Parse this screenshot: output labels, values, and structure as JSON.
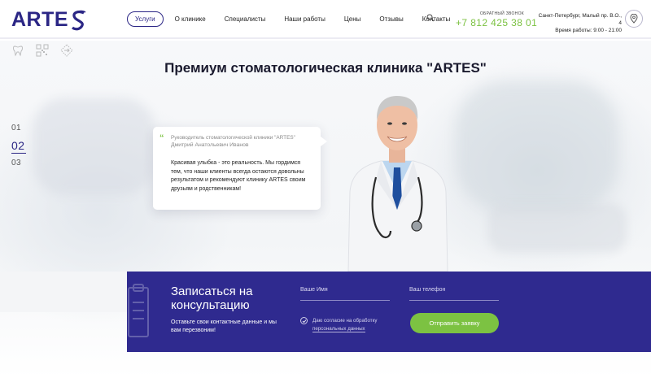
{
  "brand": {
    "logo_text": "ARTE",
    "primary": "#2b2685",
    "accent": "#7cc242"
  },
  "nav": {
    "items": [
      {
        "label": "Услуги"
      },
      {
        "label": "О клинике"
      },
      {
        "label": "Специалисты"
      },
      {
        "label": "Наши работы"
      },
      {
        "label": "Цены"
      },
      {
        "label": "Отзывы"
      },
      {
        "label": "Контакты"
      }
    ],
    "search_icon": "search-icon"
  },
  "contact": {
    "callback_label": "ОБРАТНЫЙ ЗВОНОК",
    "phone": "+7 812 425 38 01",
    "address": "Санкт-Петербург, Малый пр. В.О., 4",
    "hours": "Время работы: 9:00 - 21:00",
    "map_icon": "map-pin-icon"
  },
  "hero": {
    "title": "Премиум стоматологическая клиника \"ARTES\"",
    "slides": [
      "01",
      "02",
      "03"
    ],
    "active_slide": "02"
  },
  "quote": {
    "mark": "“",
    "role": "Руководитель стоматологической клиники \"ARTES\"",
    "name": "Дмитрий Анатольевич Иванов",
    "text": "Красивая улыбка - это реальность. Мы гордимся тем, что наши клиенты всегда остаются довольны результатом и рекомендуют клинику ARTES своим друзьям и родственникам!"
  },
  "form": {
    "title": "Записаться на конcультацию",
    "subtitle": "Оставьте свои контактные данные и мы вам перезвоним!",
    "name_placeholder": "Ваше Имя",
    "phone_placeholder": "Ваш телефон",
    "consent_prefix": "Даю согласие на обработку",
    "consent_link": "персональных данных",
    "submit_label": "Отправить заявку"
  }
}
